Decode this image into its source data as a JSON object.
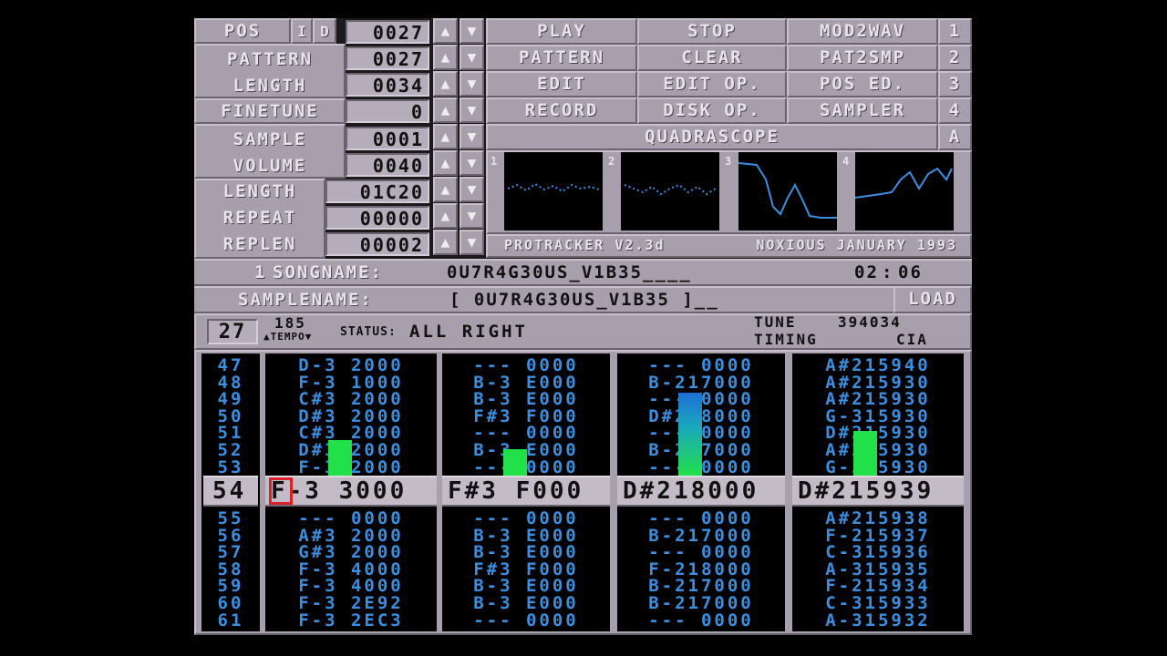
{
  "left_panel": [
    {
      "label": "POS",
      "value": "0027"
    },
    {
      "label": "PATTERN",
      "value": "0027"
    },
    {
      "label": "LENGTH",
      "value": "0034"
    },
    {
      "label": "FINETUNE",
      "value": "0"
    },
    {
      "label": "SAMPLE",
      "value": "0001"
    },
    {
      "label": "VOLUME",
      "value": "0040"
    },
    {
      "label": "LENGTH",
      "value": "01C20"
    },
    {
      "label": "REPEAT",
      "value": "00000"
    },
    {
      "label": "REPLEN",
      "value": "00002"
    }
  ],
  "pos_flags": {
    "i": "I",
    "d": "D"
  },
  "arrows": {
    "up": "▲",
    "down": "▼"
  },
  "buttons": {
    "row1": [
      "PLAY",
      "STOP",
      "MOD2WAV",
      "1"
    ],
    "row2": [
      "PATTERN",
      "CLEAR",
      "PAT2SMP",
      "2"
    ],
    "row3": [
      "EDIT",
      "EDIT OP.",
      "POS ED.",
      "3"
    ],
    "row4": [
      "RECORD",
      "DISK OP.",
      "SAMPLER",
      "4"
    ],
    "quadrascope": "QUADRASCOPE",
    "quad_key": "A",
    "load": "LOAD"
  },
  "scopes": {
    "nums": [
      "1",
      "2",
      "3",
      "4"
    ]
  },
  "about": {
    "left": "PROTRACKER V2.3d",
    "right": "NOXIOUS JANUARY 1993"
  },
  "song": {
    "prefix": "1",
    "label": "SONGNAME:",
    "name": "0U7R4G30US_V1B35____",
    "time_min": "02",
    "time_sep": ":",
    "time_sec": "06"
  },
  "samplename": {
    "label": "SAMPLENAME:",
    "name": "[ 0U7R4G30US_V1B35 ]__"
  },
  "status": {
    "pos_box": "27",
    "tempo": "185",
    "tempo_label": "TEMPO",
    "status_label": "STATUS:",
    "status_text": "ALL RIGHT",
    "tune_label": "TUNE",
    "tune_value": "394034",
    "timing_label": "TIMING",
    "timing_value": "CIA"
  },
  "pattern": {
    "row_numbers_above": [
      "47",
      "48",
      "49",
      "50",
      "51",
      "52",
      "53"
    ],
    "row_numbers_below": [
      "55",
      "56",
      "57",
      "58",
      "59",
      "60",
      "61"
    ],
    "current_row": "54",
    "channels": [
      {
        "above": [
          "D-3 2000",
          "F-3 1000",
          "C#3 2000",
          "D#3 2000",
          "C#3 2000",
          "D#3 2000",
          "F-3 2000"
        ],
        "current": "F-3 3000",
        "below": [
          "--- 0000",
          "A#3 2000",
          "G#3 2000",
          "F-3 4000",
          "F-3 4000",
          "F-3 2E92",
          "F-3 2EC3"
        ]
      },
      {
        "above": [
          "--- 0000",
          "B-3 E000",
          "B-3 E000",
          "F#3 F000",
          "--- 0000",
          "B-3 E000",
          "--- 0000"
        ],
        "current": "F#3 F000",
        "below": [
          "--- 0000",
          "B-3 E000",
          "B-3 E000",
          "F#3 F000",
          "B-3 E000",
          "B-3 E000",
          "--- 0000"
        ]
      },
      {
        "above": [
          "--- 0000",
          "B-217000",
          "--- 0000",
          "D#218000",
          "--- 0000",
          "B-217000",
          "--- 0000"
        ],
        "current": "D#218000",
        "below": [
          "--- 0000",
          "B-217000",
          "--- 0000",
          "F-218000",
          "B-217000",
          "B-217000",
          "--- 0000"
        ]
      },
      {
        "above": [
          "A#215940",
          "A#215930",
          "A#215930",
          "G-315930",
          "D#215930",
          "A#215930",
          "G-315930"
        ],
        "current": "D#215939",
        "below": [
          "A#215938",
          "F-215937",
          "C-315936",
          "A-315935",
          "F-215934",
          "C-315933",
          "A-315932"
        ]
      }
    ]
  },
  "vu_levels": [
    0.3,
    0.22,
    0.7,
    0.38
  ],
  "colors": {
    "panel": "#a89fac",
    "note": "#3b8fe0",
    "vu_green": "#22e04a",
    "vu_blue": "#1f6fd6",
    "cursor": "#d8222a"
  }
}
